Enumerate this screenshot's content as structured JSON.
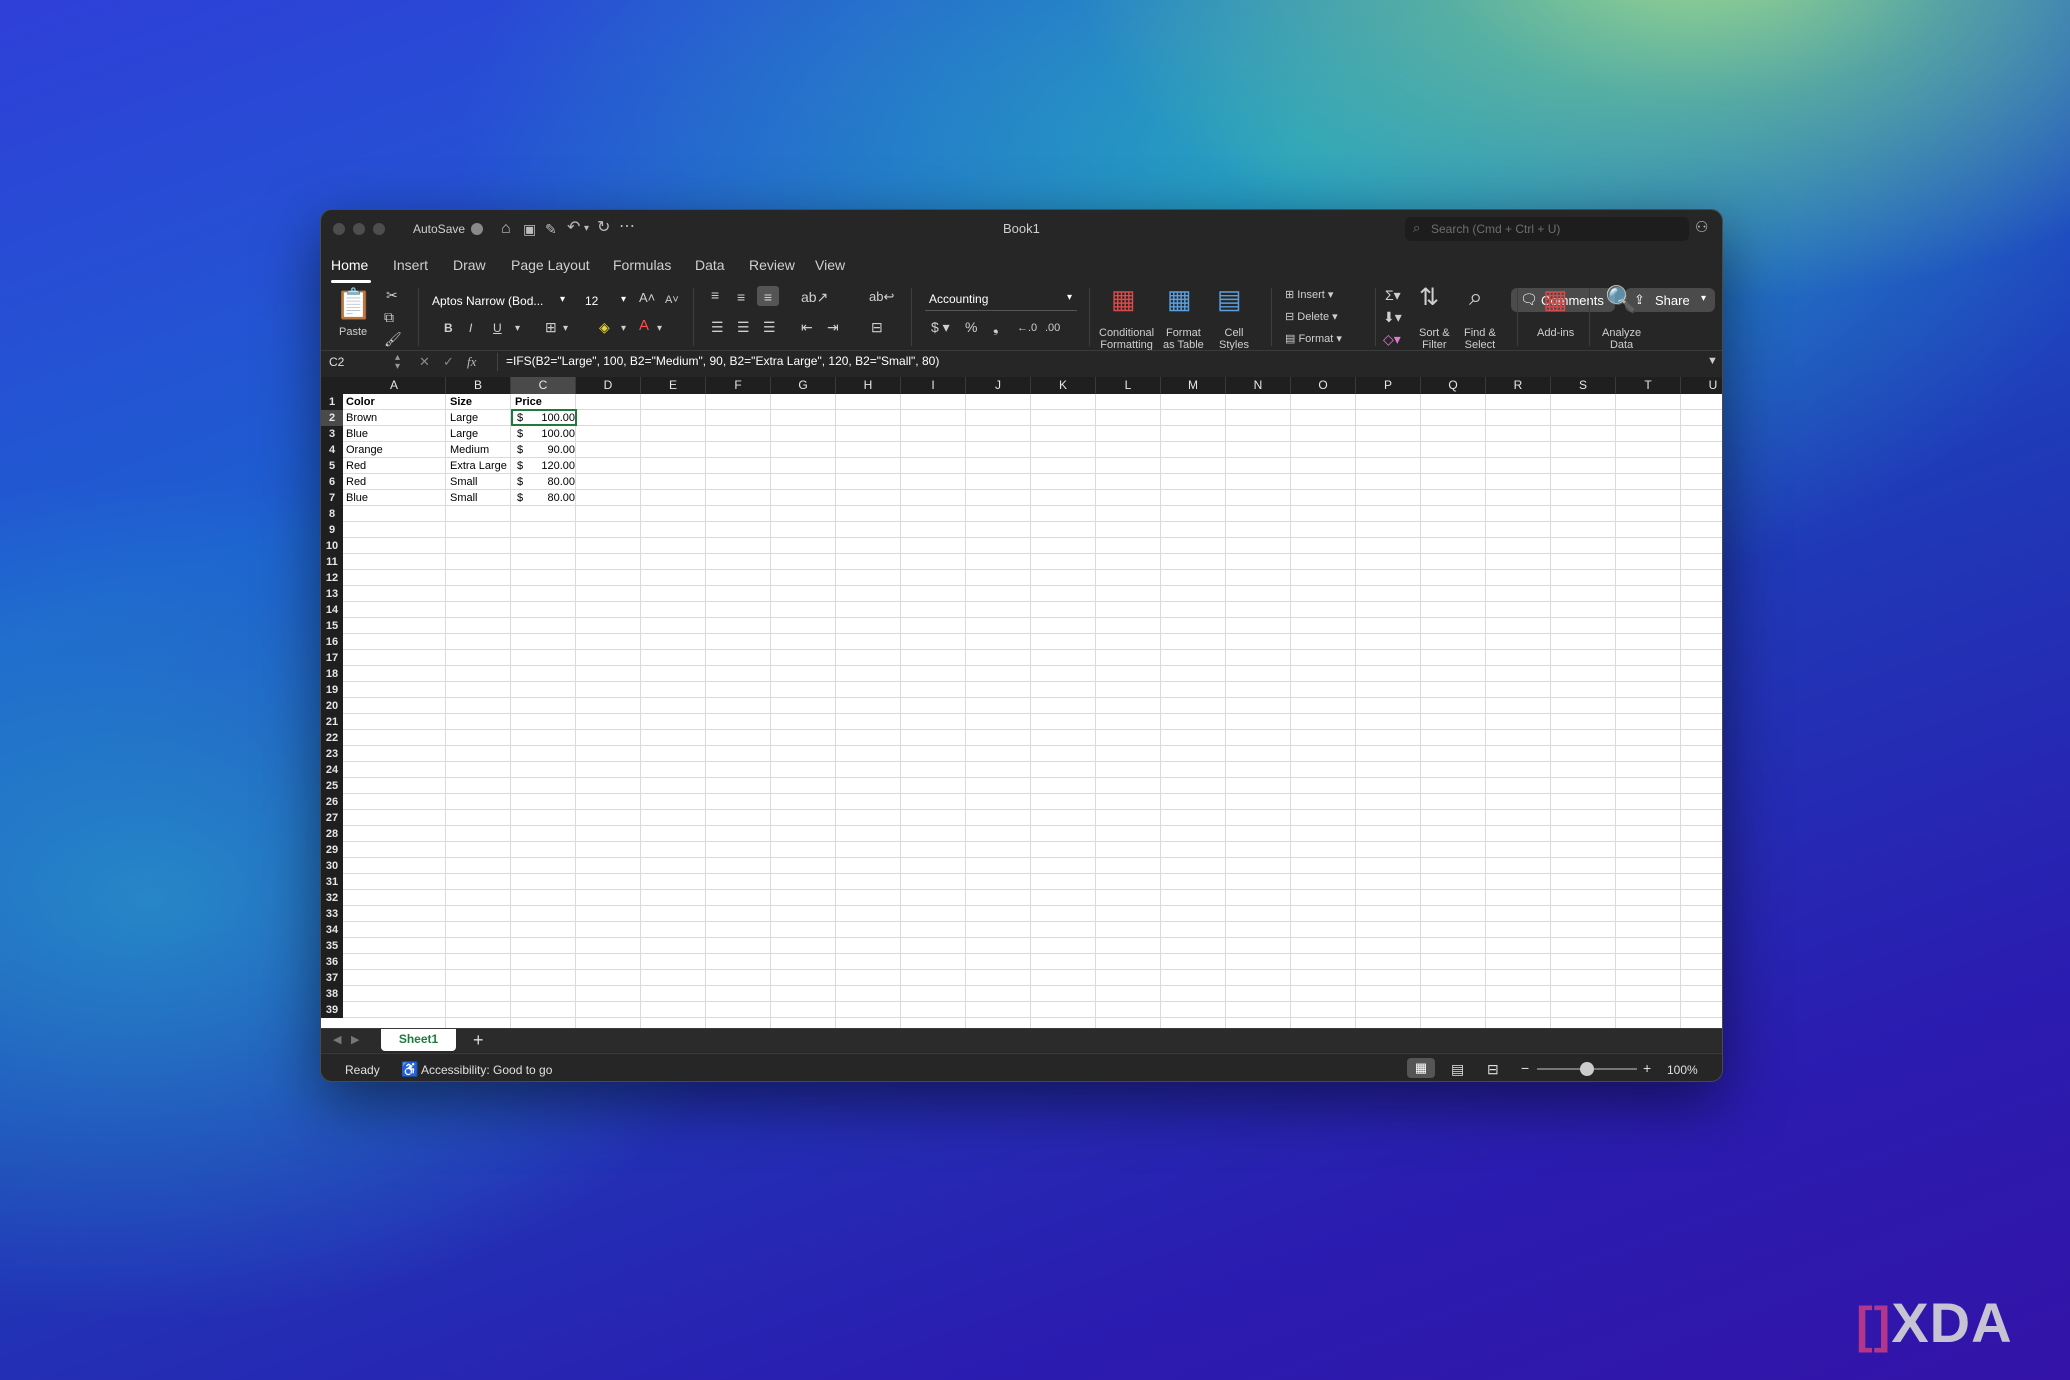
{
  "window": {
    "title": "Book1",
    "autosave_label": "AutoSave",
    "search_placeholder": "Search (Cmd + Ctrl + U)"
  },
  "tabs": [
    "Home",
    "Insert",
    "Draw",
    "Page Layout",
    "Formulas",
    "Data",
    "Review",
    "View"
  ],
  "header_buttons": {
    "comments": "Comments",
    "share": "Share"
  },
  "ribbon": {
    "paste": "Paste",
    "font_name": "Aptos Narrow (Bod...",
    "font_size": "12",
    "number_format": "Accounting",
    "conditional_formatting": "Conditional\nFormatting",
    "format_as_table": "Format\nas Table",
    "cell_styles": "Cell\nStyles",
    "insert": "Insert",
    "delete": "Delete",
    "format": "Format",
    "sort_filter": "Sort &\nFilter",
    "find_select": "Find &\nSelect",
    "addins": "Add-ins",
    "analyze_data": "Analyze\nData"
  },
  "formula_bar": {
    "name_box": "C2",
    "fx": "fx",
    "formula": "=IFS(B2=\"Large\", 100, B2=\"Medium\", 90, B2=\"Extra Large\", 120, B2=\"Small\", 80)"
  },
  "columns": [
    "A",
    "B",
    "C",
    "D",
    "E",
    "F",
    "G",
    "H",
    "I",
    "J",
    "K",
    "L",
    "M",
    "N",
    "O",
    "P",
    "Q",
    "R",
    "S",
    "T",
    "U"
  ],
  "rows": [
    "1",
    "2",
    "3",
    "4",
    "5",
    "6",
    "7",
    "8",
    "9",
    "10",
    "11",
    "12",
    "13",
    "14",
    "15",
    "16",
    "17",
    "18",
    "19",
    "20",
    "21",
    "22",
    "23",
    "24",
    "25",
    "26",
    "27",
    "28",
    "29",
    "30",
    "31",
    "32",
    "33",
    "34",
    "35",
    "36",
    "37",
    "38",
    "39"
  ],
  "selected_cell": {
    "column": "C",
    "row": "2"
  },
  "table": {
    "headers": [
      "Color",
      "Size",
      "Price"
    ],
    "rows": [
      [
        "Brown",
        "Large",
        "$",
        "100.00"
      ],
      [
        "Blue",
        "Large",
        "$",
        "100.00"
      ],
      [
        "Orange",
        "Medium",
        "$",
        "90.00"
      ],
      [
        "Red",
        "Extra Large",
        "$",
        "120.00"
      ],
      [
        "Red",
        "Small",
        "$",
        "80.00"
      ],
      [
        "Blue",
        "Small",
        "$",
        "80.00"
      ]
    ]
  },
  "sheet_tabs": [
    "Sheet1"
  ],
  "status": {
    "ready": "Ready",
    "accessibility": "Accessibility: Good to go",
    "zoom": "100%"
  },
  "watermark": "XDA"
}
